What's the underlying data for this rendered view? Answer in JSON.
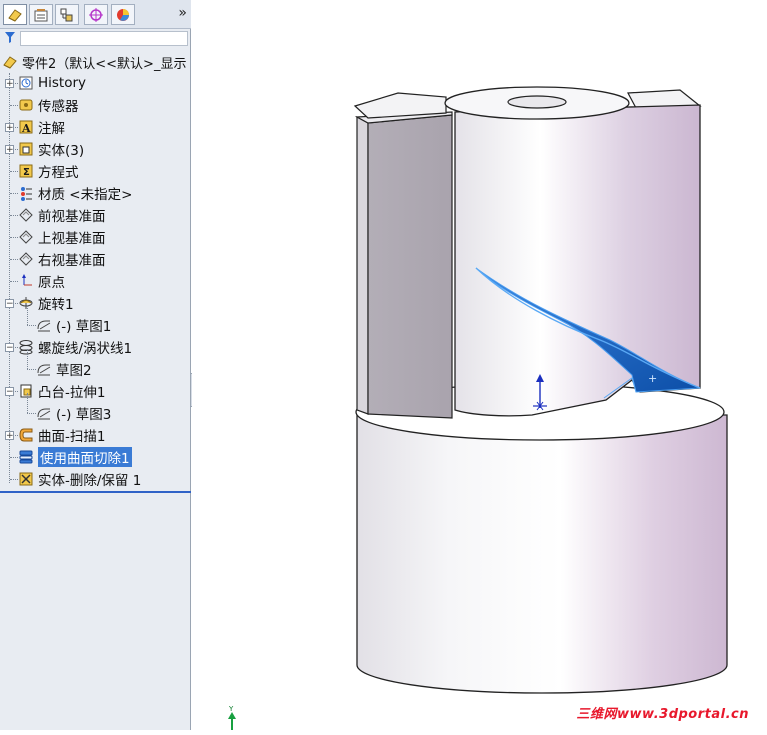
{
  "toolbar": {
    "tabs": [
      {
        "icon": "feature-manager-icon",
        "active": true
      },
      {
        "icon": "property-manager-icon",
        "active": false
      },
      {
        "icon": "configuration-manager-icon",
        "active": false
      },
      {
        "icon": "dimxpert-icon",
        "active": false
      },
      {
        "icon": "display-manager-icon",
        "active": false
      }
    ],
    "more_label": "»"
  },
  "filter": {
    "icon": "filter-icon",
    "value": ""
  },
  "tree": {
    "root_label": "零件2（默认<<默认>_显示",
    "items": [
      {
        "label": "History",
        "icon": "history-icon",
        "expandable": true
      },
      {
        "label": "传感器",
        "icon": "sensor-icon",
        "expandable": false
      },
      {
        "label": "注解",
        "icon": "annotation-icon",
        "expandable": true
      },
      {
        "label": "实体(3)",
        "icon": "solid-bodies-icon",
        "expandable": true
      },
      {
        "label": "方程式",
        "icon": "equations-icon",
        "expandable": false
      },
      {
        "label": "材质 <未指定>",
        "icon": "material-icon",
        "expandable": false
      },
      {
        "label": "前视基准面",
        "icon": "plane-icon",
        "expandable": false
      },
      {
        "label": "上视基准面",
        "icon": "plane-icon",
        "expandable": false
      },
      {
        "label": "右视基准面",
        "icon": "plane-icon",
        "expandable": false
      },
      {
        "label": "原点",
        "icon": "origin-icon",
        "expandable": false
      },
      {
        "label": "旋转1",
        "icon": "revolve-icon",
        "expandable": true,
        "expanded": true
      },
      {
        "label": "(-) 草图1",
        "icon": "sketch-icon",
        "child": true
      },
      {
        "label": "螺旋线/涡状线1",
        "icon": "helix-icon",
        "expandable": true,
        "expanded": true
      },
      {
        "label": "草图2",
        "icon": "sketch-icon",
        "child": true
      },
      {
        "label": "凸台-拉伸1",
        "icon": "extrude-icon",
        "expandable": true,
        "expanded": true
      },
      {
        "label": "(-) 草图3",
        "icon": "sketch-icon",
        "child": true
      },
      {
        "label": "曲面-扫描1",
        "icon": "sweep-surface-icon",
        "expandable": true
      },
      {
        "label": "使用曲面切除1",
        "icon": "surface-cut-icon",
        "expandable": false,
        "selected": true
      },
      {
        "label": "实体-删除/保留 1",
        "icon": "delete-body-icon",
        "expandable": false
      }
    ]
  },
  "viewport": {
    "triad_axis": "Y",
    "watermark": "三维网www.3dportal.cn"
  },
  "colors": {
    "selection": "#3a7bd5",
    "panel_bg": "#e8ecf2",
    "helix_face": "#1f5fbf",
    "watermark": "#e8182c"
  }
}
